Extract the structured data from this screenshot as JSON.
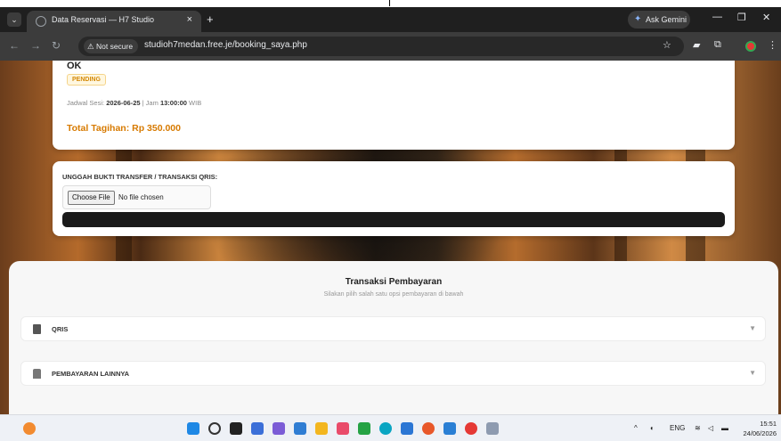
{
  "browser": {
    "tab_title": "Data Reservasi — H7 Studio",
    "tab_close": "×",
    "new_tab": "+",
    "gemini_label": "Ask Gemini",
    "minimize": "—",
    "restore": "❐",
    "close": "✕",
    "not_secure": "Not secure",
    "url": "studioh7medan.free.je/booking_saya.php"
  },
  "booking": {
    "title": "OK",
    "status": "PENDING",
    "schedule_prefix": "Jadwal Sesi: ",
    "schedule_date": "2026-06-25",
    "schedule_sep": " | Jam ",
    "schedule_time": "13:00:00",
    "schedule_suffix": " WIB",
    "total": "Total Tagihan: Rp 350.000"
  },
  "upload": {
    "label": "UNGGAH BUKTI TRANSFER / TRANSAKSI QRIS:",
    "choose_button": "Choose File",
    "no_file": "No file chosen"
  },
  "payment": {
    "title": "Transaksi Pembayaran",
    "subtitle": "Silakan pilih salah satu opsi pembayaran di bawah",
    "options": [
      {
        "label": "QRIS",
        "icon": "qr-doc-icon"
      },
      {
        "label": "PEMBAYARAN LAINNYA",
        "icon": "bank-icon"
      }
    ]
  },
  "taskbar": {
    "lang": "ENG",
    "time": "15:51",
    "date": "24/06/2026"
  },
  "colors": {
    "accent": "#d77a00",
    "pending": "#d48806"
  }
}
